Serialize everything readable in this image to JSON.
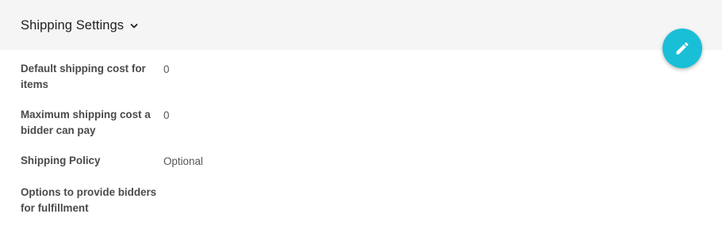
{
  "section": {
    "title": "Shipping Settings",
    "collapse_icon": "chevron-down-icon",
    "edit_icon": "pencil-icon"
  },
  "fields": [
    {
      "label": "Default shipping cost for items",
      "value": "0"
    },
    {
      "label": "Maximum shipping cost a bidder can pay",
      "value": "0"
    },
    {
      "label": "Shipping Policy",
      "value": "Optional"
    },
    {
      "label": "Options to provide bidders for fulfillment",
      "value": ""
    }
  ],
  "colors": {
    "header_bg": "#f5f5f5",
    "fab_bg": "#19bfd6",
    "label": "#4a4a4a",
    "value": "#555555"
  }
}
